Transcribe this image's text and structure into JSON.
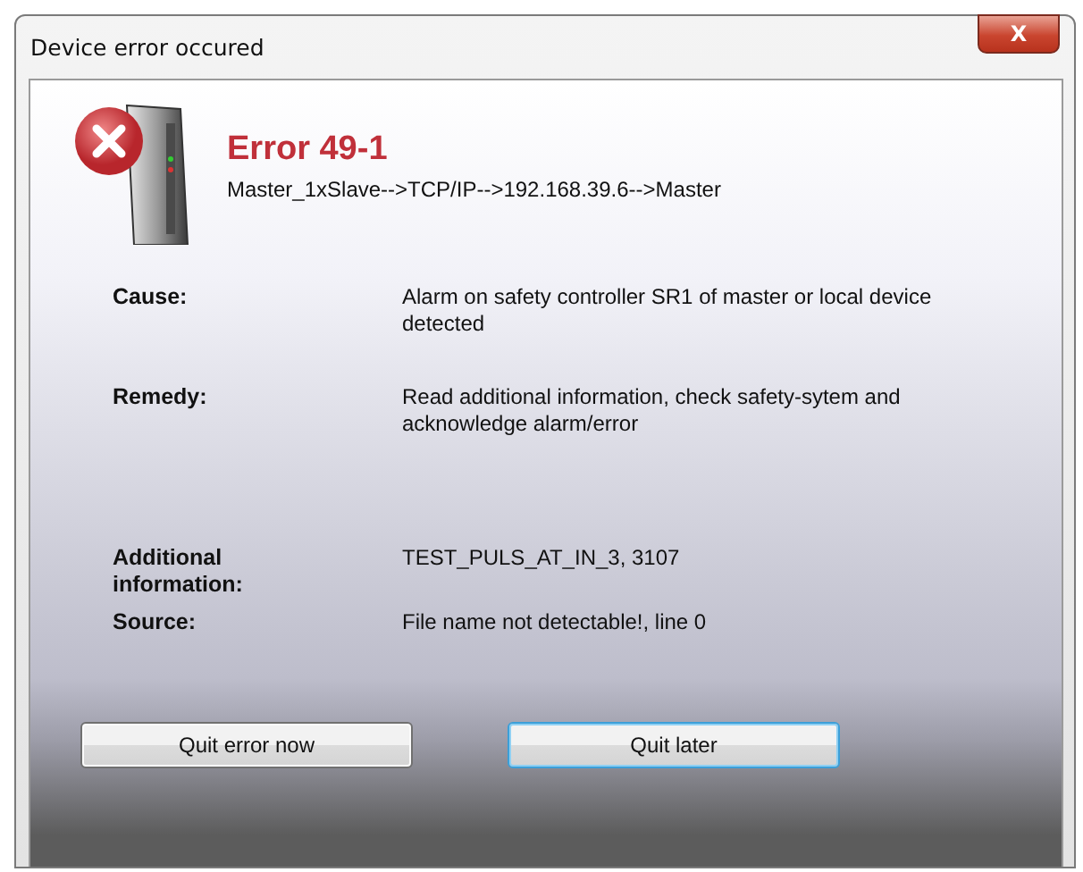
{
  "window": {
    "title": "Device error occured",
    "close_label": "X"
  },
  "error": {
    "title": "Error 49-1",
    "path": "Master_1xSlave-->TCP/IP-->192.168.39.6-->Master"
  },
  "details": [
    {
      "label": "Cause:",
      "value": "Alarm on safety controller SR1 of master or local device detected"
    },
    {
      "label": "Remedy:",
      "value": "Read additional information, check safety-sytem and acknowledge alarm/error"
    },
    {
      "label": "Additional information:",
      "value": "TEST_PULS_AT_IN_3, 3107"
    },
    {
      "label": "Source:",
      "value": "File name not detectable!, line 0"
    }
  ],
  "buttons": [
    {
      "label": "Quit error now",
      "focused": false
    },
    {
      "label": "Quit later",
      "focused": true
    }
  ]
}
